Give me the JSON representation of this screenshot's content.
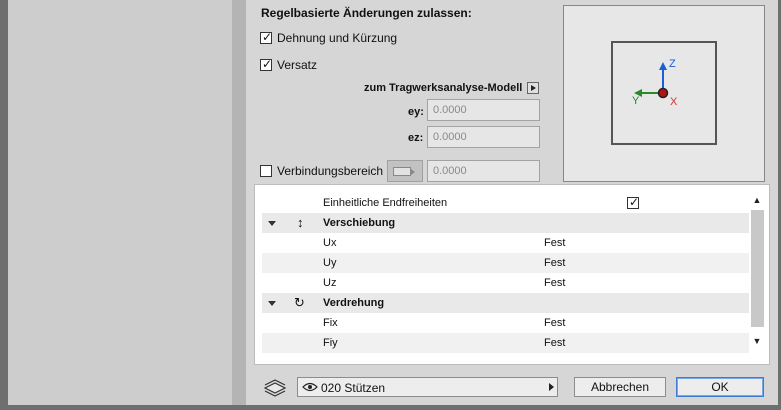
{
  "rules": {
    "section_title": "Regelbasierte Änderungen zulassen:",
    "stretch": {
      "label": "Dehnung und Kürzung",
      "checked": true
    },
    "offset": {
      "label": "Versatz",
      "checked": true
    },
    "model_button": {
      "label": "zum Tragwerksanalyse-Modell"
    },
    "ey": {
      "label": "ey:",
      "value": "0.0000"
    },
    "ez": {
      "label": "ez:",
      "value": "0.0000"
    },
    "connection": {
      "label": "Verbindungsbereich",
      "checked": false,
      "value": "0.0000"
    }
  },
  "preview": {
    "axes": {
      "z": "Z",
      "y": "Y",
      "x": "X"
    },
    "colors": {
      "z": "#1a5fd6",
      "y": "#2a8a2a",
      "x": "#d23333",
      "origin": "#b01515"
    }
  },
  "table": {
    "header_row": {
      "label": "Einheitliche Endfreiheiten",
      "checked": true
    },
    "groups": [
      {
        "name": "Verschiebung",
        "icon": "updown-arrow-icon",
        "rows": [
          {
            "name": "Ux",
            "value": "Fest"
          },
          {
            "name": "Uy",
            "value": "Fest"
          },
          {
            "name": "Uz",
            "value": "Fest"
          }
        ]
      },
      {
        "name": "Verdrehung",
        "icon": "rotation-icon",
        "rows": [
          {
            "name": "Fix",
            "value": "Fest"
          },
          {
            "name": "Fiy",
            "value": "Fest"
          }
        ]
      }
    ]
  },
  "footer": {
    "layer": "020 Stützen",
    "cancel": "Abbrechen",
    "ok": "OK"
  }
}
